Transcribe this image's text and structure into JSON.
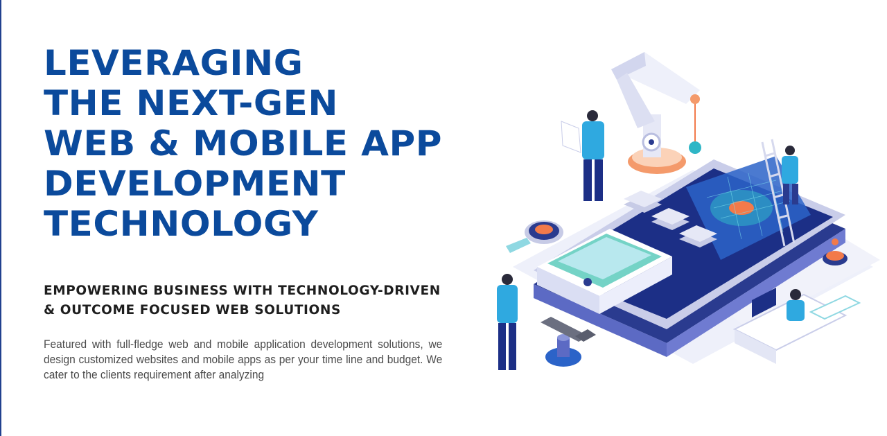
{
  "hero": {
    "title_lines": [
      "LEVERAGING",
      "THE NEXT-GEN",
      "WEB & MOBILE APP",
      "DEVELOPMENT",
      "TECHNOLOGY"
    ]
  },
  "subtitle": {
    "lines": [
      "EMPOWERING BUSINESS WITH TECHNOLOGY-DRIVEN",
      "& OUTCOME FOCUSED WEB SOLUTIONS"
    ]
  },
  "description": {
    "text": "Featured with full-fledge web and mobile application development solutions, we design customized websites and mobile apps as per your time line and budget. We cater to the clients requirement after analyzing"
  },
  "colors": {
    "heading": "#0b4a9c",
    "subheading": "#1e1e1e",
    "body": "#4a4a4a",
    "accent_blue": "#21418f",
    "accent_teal": "#2fb6c6",
    "accent_orange": "#f27a4a"
  },
  "illustration": {
    "icon_names": [
      "isometric-phone-icon",
      "robot-arm-icon",
      "developer-person-icon",
      "laptop-icon",
      "gear-icon",
      "magnifier-icon",
      "ladder-icon"
    ]
  }
}
